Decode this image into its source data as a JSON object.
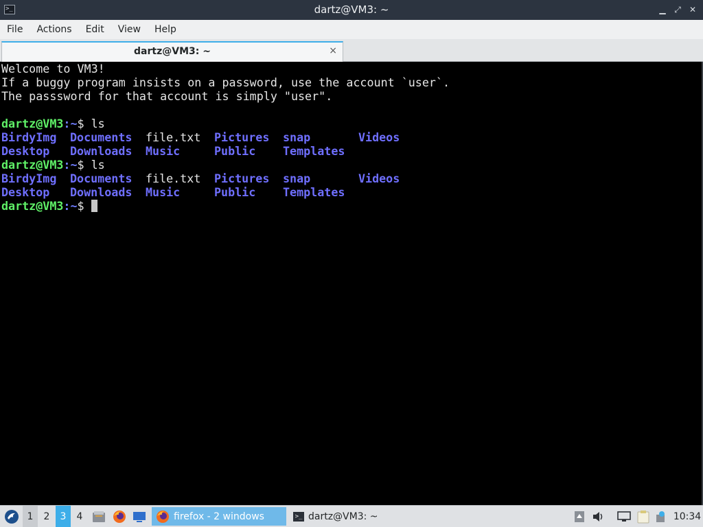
{
  "window": {
    "title": "dartz@VM3: ~"
  },
  "menu": [
    "File",
    "Actions",
    "Edit",
    "View",
    "Help"
  ],
  "tab": {
    "label": "dartz@VM3: ~",
    "close": "×"
  },
  "terminal": {
    "motd": [
      "Welcome to VM3!",
      "If a buggy program insists on a password, use the account `user`.",
      "The passsword for that account is simply \"user\"."
    ],
    "prompt_user": "dartz@VM3",
    "prompt_path": ":~",
    "prompt_symbol": "$ ",
    "command": "ls",
    "ls_row1": [
      "BirdyImg",
      "Documents",
      "file.txt",
      "Pictures",
      "snap",
      "Videos"
    ],
    "ls_row2": [
      "Desktop",
      "Downloads",
      "Music",
      "Public",
      "Templates"
    ]
  },
  "taskbar": {
    "workspaces": [
      "1",
      "2",
      "3",
      "4"
    ],
    "tasks": [
      {
        "label": "firefox - 2 windows"
      },
      {
        "label": "dartz@VM3: ~"
      }
    ],
    "clock": "10:34"
  },
  "colors": {
    "accent": "#3daee9",
    "prompt_user": "#5ff067",
    "directory": "#6f6fff"
  }
}
